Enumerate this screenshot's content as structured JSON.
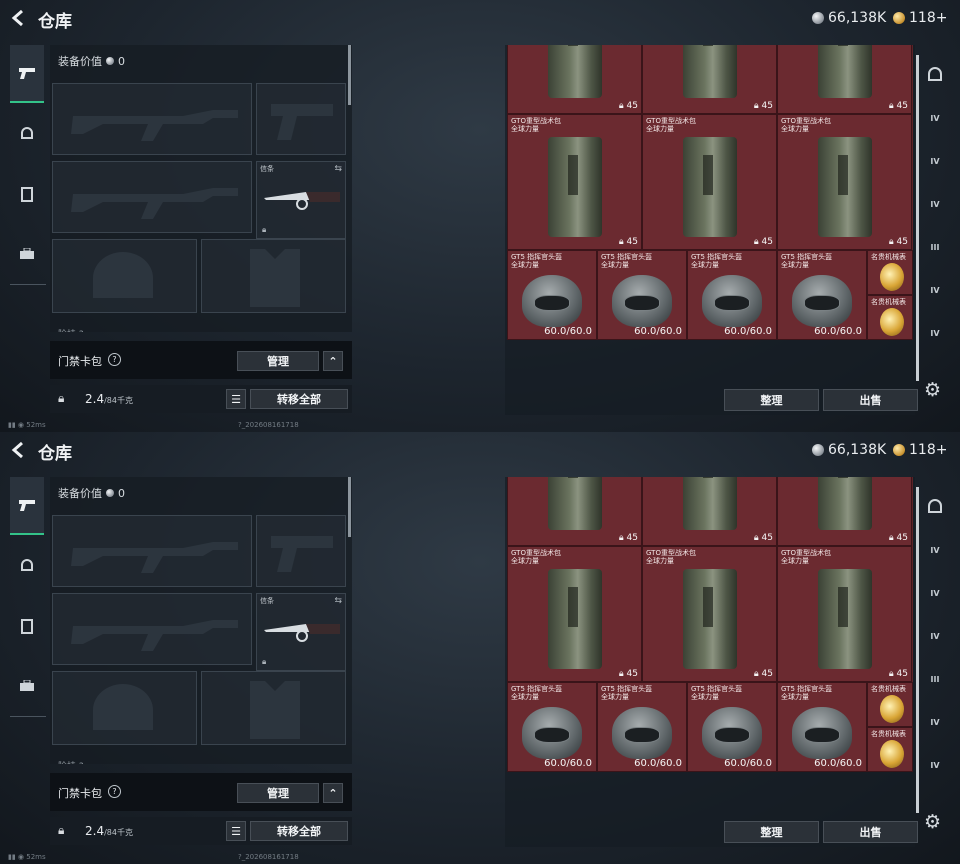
{
  "screens": [
    {
      "top_label": "仓库",
      "silver_amount": "66,138K",
      "gold_amount": "118+",
      "equipment_value_label": "装备价值",
      "equipment_value": "0",
      "knife_slot_label": "信条",
      "sub_section_label": "险挂  ?",
      "access_card_label": "门禁卡包",
      "access_card_help": "?",
      "manage_button": "管理",
      "capacity_value": "2.4",
      "capacity_max": "/84千克",
      "transfer_all_button": "转移全部",
      "ping": "52ms",
      "build_id": "?_202608161718",
      "sort_button": "整理",
      "sell_button": "出售",
      "backpack_name": "GTO重型战术包",
      "backpack_sub": "全球力量",
      "backpack_count": "45",
      "helmet_name": "GT5 指挥官头盔",
      "helmet_sub": "全球力量",
      "helmet_durability": "60.0/60.0",
      "watch_name": "名贵机械表"
    },
    {
      "top_label": "仓库",
      "silver_amount": "66,138K",
      "gold_amount": "118+",
      "equipment_value_label": "装备价值",
      "equipment_value": "0",
      "knife_slot_label": "信条",
      "sub_section_label": "险挂  ?",
      "access_card_label": "门禁卡包",
      "access_card_help": "?",
      "manage_button": "管理",
      "capacity_value": "2.4",
      "capacity_max": "/84千克",
      "transfer_all_button": "转移全部",
      "ping": "52ms",
      "build_id": "?_202608161718",
      "sort_button": "整理",
      "sell_button": "出售",
      "backpack_name": "GTO重型战术包",
      "backpack_sub": "全球力量",
      "backpack_count": "45",
      "helmet_name": "GT5 指挥官头盔",
      "helmet_sub": "全球力量",
      "helmet_durability": "60.0/60.0",
      "watch_name": "名贵机械表"
    }
  ],
  "colors": {
    "accent_green": "#33c389",
    "inventory_bg": "#6b2a30"
  },
  "icons": [
    "back-arrow-icon",
    "pistol-icon",
    "helmet-icon",
    "vest-icon",
    "case-icon",
    "gear-icon",
    "lock-icon",
    "list-icon",
    "swap-icon",
    "chevron-up-icon"
  ]
}
